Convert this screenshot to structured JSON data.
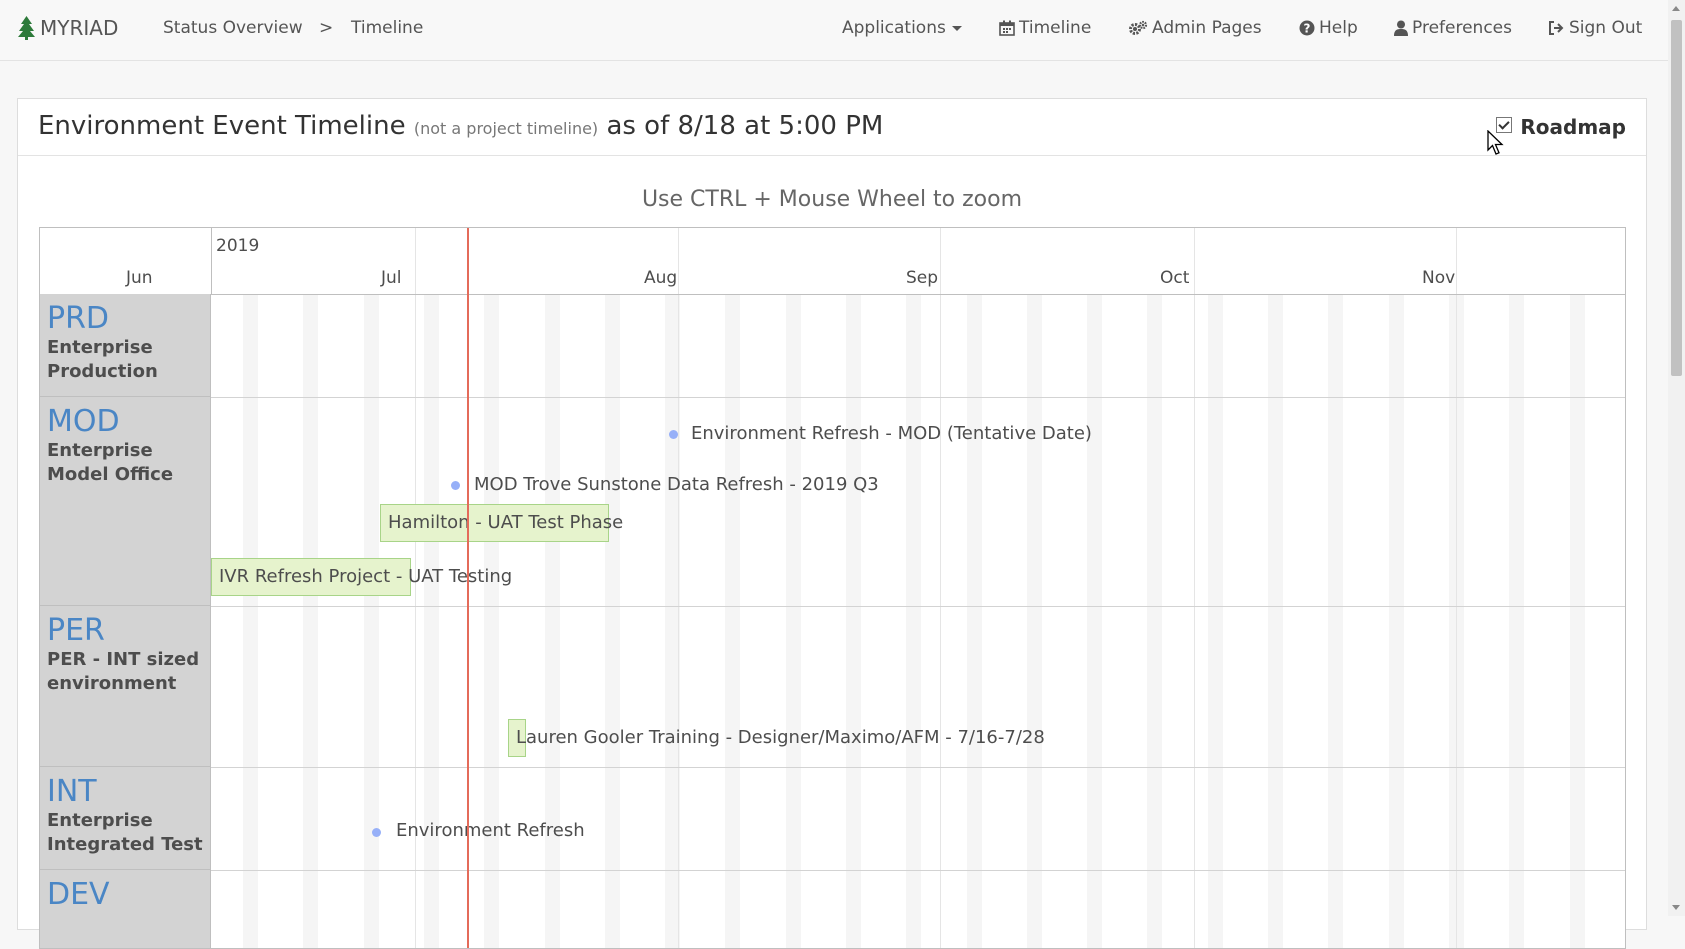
{
  "nav": {
    "brand": "MYRIAD",
    "breadcrumb": [
      "Status Overview",
      ">",
      "Timeline"
    ],
    "menu": {
      "applications": "Applications",
      "timeline": "Timeline",
      "admin": "Admin Pages",
      "help": "Help",
      "preferences": "Preferences",
      "signout": "Sign Out"
    }
  },
  "panel": {
    "title_main": "Environment Event Timeline",
    "title_note": "(not a project timeline)",
    "title_asof": "as of 8/18 at 5:00 PM",
    "roadmap_label": "Roadmap",
    "roadmap_checked": true,
    "zoom_hint": "Use CTRL + Mouse Wheel to zoom"
  },
  "timeline": {
    "year": "2019",
    "months": [
      "Jun",
      "Jul",
      "Aug",
      "Sep",
      "Oct",
      "Nov"
    ],
    "groups": [
      {
        "code": "PRD",
        "desc": "Enterprise Production"
      },
      {
        "code": "MOD",
        "desc": "Enterprise Model Office"
      },
      {
        "code": "PER",
        "desc": "PER - INT sized environment"
      },
      {
        "code": "INT",
        "desc": "Enterprise Integrated Test"
      },
      {
        "code": "DEV",
        "desc": ""
      }
    ],
    "events": {
      "mod_refresh": "Environment Refresh - MOD (Tentative Date)",
      "mod_trove": "MOD Trove Sunstone Data Refresh - 2019 Q3",
      "hamilton": "Hamilton - UAT Test Phase",
      "ivr": "IVR Refresh Project - UAT Testing",
      "lauren": "Lauren Gooler Training - Designer/Maximo/AFM - 7/16-7/28",
      "int_refresh": "Environment Refresh"
    }
  },
  "colors": {
    "link": "#4a86c5",
    "now_line": "#e46b5a",
    "range_fill": "#e6f3cd",
    "point": "#97b0f8"
  }
}
